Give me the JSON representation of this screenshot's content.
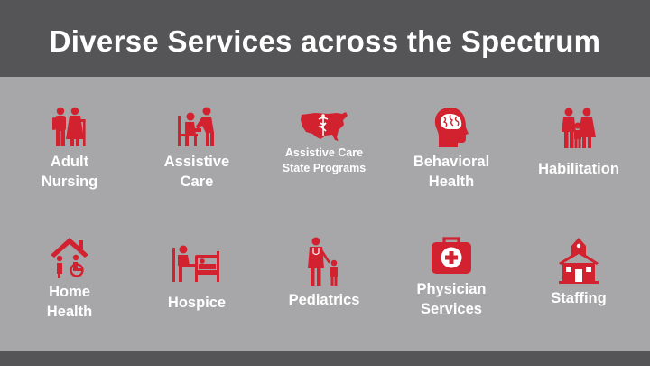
{
  "title": "Diverse Services across the Spectrum",
  "colors": {
    "accent": "#d2212f",
    "header": "#555557",
    "background": "#a7a6a8",
    "text": "#ffffff"
  },
  "services": [
    {
      "icon": "elderly-couple-icon",
      "line1": "Adult",
      "line2": "Nursing"
    },
    {
      "icon": "caregiver-icon",
      "line1": "Assistive",
      "line2": "Care"
    },
    {
      "icon": "us-map-caduceus-icon",
      "line1": "Assistive Care",
      "line2": "State Programs"
    },
    {
      "icon": "brain-head-icon",
      "line1": "Behavioral",
      "line2": "Health"
    },
    {
      "icon": "family-icon",
      "line1": "Habilitation"
    },
    {
      "icon": "house-wheelchair-icon",
      "line1": "Home",
      "line2": "Health"
    },
    {
      "icon": "hospital-bed-icon",
      "line1": "Hospice"
    },
    {
      "icon": "doctor-child-icon",
      "line1": "Pediatrics"
    },
    {
      "icon": "medical-kit-icon",
      "line1": "Physician",
      "line2": "Services"
    },
    {
      "icon": "schoolhouse-icon",
      "line1": "Staffing"
    }
  ]
}
